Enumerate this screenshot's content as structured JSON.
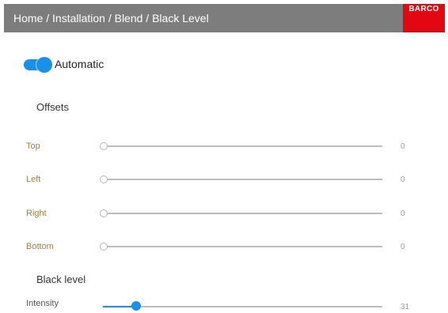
{
  "header": {
    "breadcrumb": "Home / Installation / Blend / Black Level",
    "logo_text": "BARCO",
    "background": "#7d7d7d",
    "logo_color": "#e30613"
  },
  "automatic": {
    "label": "Automatic",
    "enabled": true,
    "accent": "#1b90e8"
  },
  "offsets": {
    "title": "Offsets",
    "rows": [
      {
        "label": "Top",
        "value": "0",
        "fraction": 0
      },
      {
        "label": "Left",
        "value": "0",
        "fraction": 0
      },
      {
        "label": "Right",
        "value": "0",
        "fraction": 0
      },
      {
        "label": "Bottom",
        "value": "0",
        "fraction": 0
      }
    ]
  },
  "black_level": {
    "title": "Black level",
    "intensity": {
      "label": "Intensity",
      "value": "31",
      "fraction": 0.12
    }
  }
}
